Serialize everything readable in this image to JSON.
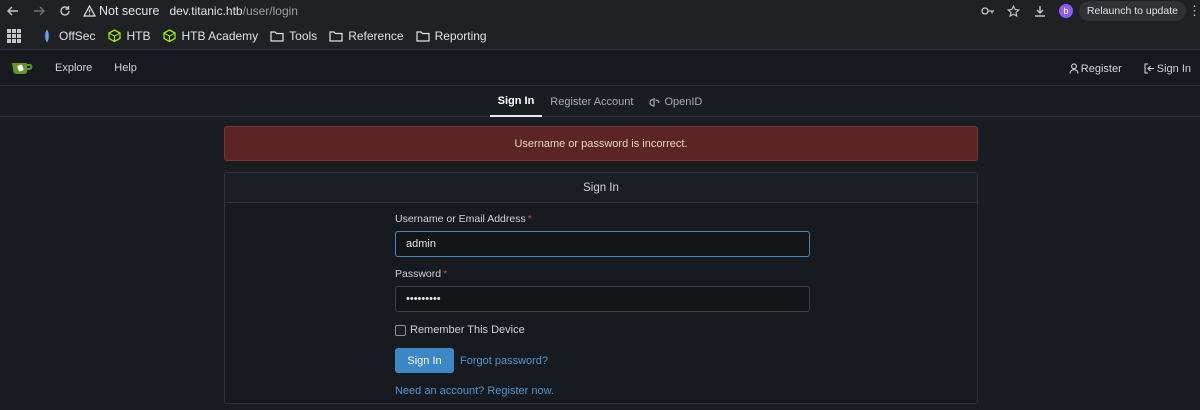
{
  "browser": {
    "security_label": "Not secure",
    "url_host": "dev.titanic.htb",
    "url_path": "/user/login",
    "profile_initial": "b",
    "relaunch_label": "Relaunch to update"
  },
  "bookmarks": [
    {
      "label": "OffSec",
      "icon": "offsec-icon"
    },
    {
      "label": "HTB",
      "icon": "htb-cube-icon"
    },
    {
      "label": "HTB Academy",
      "icon": "htb-cube-icon"
    },
    {
      "label": "Tools",
      "icon": "folder-icon"
    },
    {
      "label": "Reference",
      "icon": "folder-icon"
    },
    {
      "label": "Reporting",
      "icon": "folder-icon"
    }
  ],
  "app_nav": {
    "explore": "Explore",
    "help": "Help",
    "register": "Register",
    "sign_in": "Sign In"
  },
  "tabs": {
    "sign_in": "Sign In",
    "register_account": "Register Account",
    "openid": "OpenID"
  },
  "error_message": "Username or password is incorrect.",
  "form": {
    "title": "Sign In",
    "username_label": "Username or Email Address",
    "username_value": "admin",
    "password_label": "Password",
    "password_value": "•••••••••",
    "remember_label": "Remember This Device",
    "submit_label": "Sign In",
    "forgot_label": "Forgot password?",
    "register_prompt": "Need an account? Register now."
  },
  "colors": {
    "accent": "#3c87c6",
    "error_bg": "#5c2424",
    "page_bg": "#1a1d22"
  }
}
